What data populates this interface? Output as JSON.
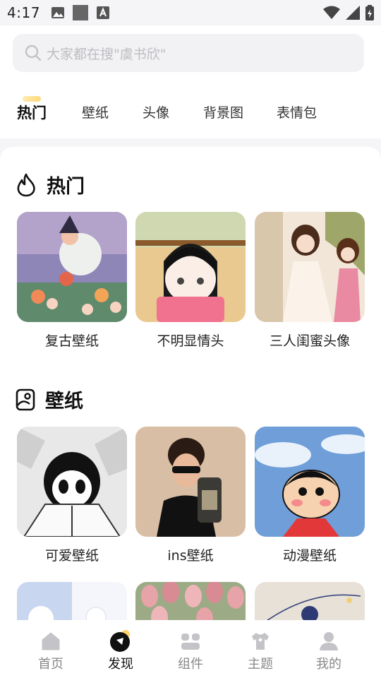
{
  "status_bar": {
    "time": "4:17"
  },
  "search": {
    "placeholder": "大家都在搜\"虞书欣\""
  },
  "tabs": [
    {
      "label": "热门",
      "active": true
    },
    {
      "label": "壁纸",
      "active": false
    },
    {
      "label": "头像",
      "active": false
    },
    {
      "label": "背景图",
      "active": false
    },
    {
      "label": "表情包",
      "active": false
    }
  ],
  "sections": [
    {
      "title": "热门",
      "icon": "flame-icon",
      "items": [
        {
          "label": "复古壁纸"
        },
        {
          "label": "不明显情头"
        },
        {
          "label": "三人闺蜜头像"
        }
      ]
    },
    {
      "title": "壁纸",
      "icon": "phone-wallpaper-icon",
      "items": [
        {
          "label": "可爱壁纸"
        },
        {
          "label": "ins壁纸"
        },
        {
          "label": "动漫壁纸"
        }
      ]
    }
  ],
  "bottom_nav": [
    {
      "label": "首页",
      "icon": "home-icon",
      "active": false
    },
    {
      "label": "发现",
      "icon": "discover-icon",
      "active": true
    },
    {
      "label": "组件",
      "icon": "widgets-icon",
      "active": false
    },
    {
      "label": "主题",
      "icon": "theme-shirt-icon",
      "active": false
    },
    {
      "label": "我的",
      "icon": "profile-icon",
      "active": false
    }
  ],
  "colors": {
    "accent": "#ffd267",
    "background": "#f5f5f7",
    "text": "#111111"
  }
}
